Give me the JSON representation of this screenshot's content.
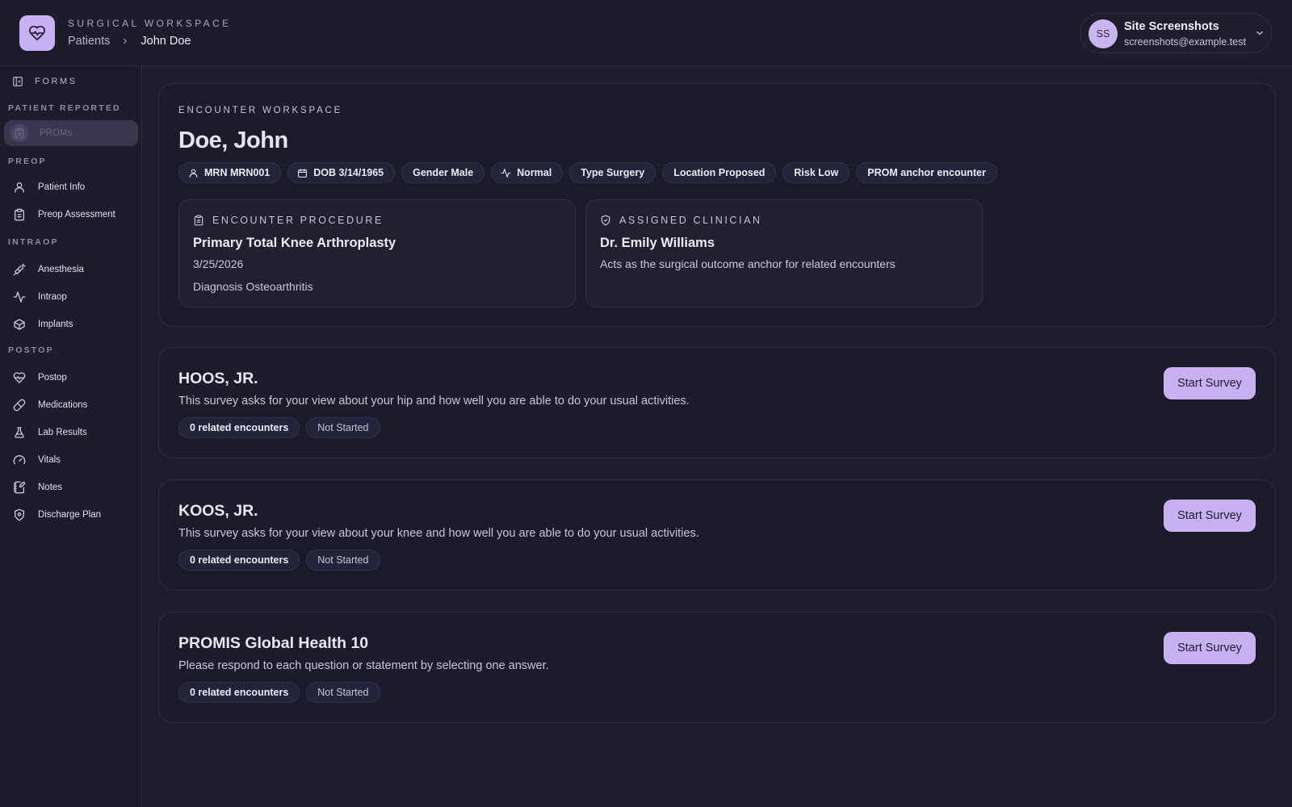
{
  "header": {
    "eyebrow": "SURGICAL WORKSPACE",
    "breadcrumb": [
      "Patients",
      "John Doe"
    ],
    "user": {
      "initials": "SS",
      "name": "Site Screenshots",
      "email": "screenshots@example.test"
    }
  },
  "sidebar": {
    "toggle_label": "FORMS",
    "sections": [
      {
        "label": "PATIENT REPORTED",
        "items": [
          {
            "label": "PROMs",
            "icon": "clipboard-icon",
            "active": true
          }
        ]
      },
      {
        "label": "PREOP",
        "items": [
          {
            "label": "Patient Info",
            "icon": "user-icon"
          },
          {
            "label": "Preop Assessment",
            "icon": "clipboard-icon"
          }
        ]
      },
      {
        "label": "INTRAOP",
        "items": [
          {
            "label": "Anesthesia",
            "icon": "syringe-icon"
          },
          {
            "label": "Intraop",
            "icon": "activity-icon"
          },
          {
            "label": "Implants",
            "icon": "box-icon"
          }
        ]
      },
      {
        "label": "POSTOP",
        "items": [
          {
            "label": "Postop",
            "icon": "heart-pulse-icon"
          },
          {
            "label": "Medications",
            "icon": "pill-icon"
          },
          {
            "label": "Lab Results",
            "icon": "flask-icon"
          },
          {
            "label": "Vitals",
            "icon": "gauge-icon"
          },
          {
            "label": "Notes",
            "icon": "notebook-icon"
          },
          {
            "label": "Discharge Plan",
            "icon": "shield-icon"
          }
        ]
      }
    ]
  },
  "encounter": {
    "eyebrow": "ENCOUNTER WORKSPACE",
    "patient_name": "Doe, John",
    "chips": {
      "mrn": "MRN MRN001",
      "dob": "DOB 3/14/1965",
      "gender": "Gender Male",
      "status": "Normal",
      "type": "Type Surgery",
      "location": "Location Proposed",
      "risk": "Risk Low",
      "anchor": "PROM anchor encounter"
    },
    "procedure": {
      "eyebrow": "ENCOUNTER PROCEDURE",
      "title": "Primary Total Knee Arthroplasty",
      "date": "3/25/2026",
      "diagnosis": "Diagnosis Osteoarthritis"
    },
    "clinician": {
      "eyebrow": "ASSIGNED CLINICIAN",
      "name": "Dr. Emily Williams",
      "note": "Acts as the surgical outcome anchor for related encounters"
    }
  },
  "surveys": [
    {
      "title": "HOOS, JR.",
      "description": "This survey asks for your view about your hip and how well you are able to do your usual activities.",
      "related": "0 related encounters",
      "status": "Not Started",
      "button": "Start Survey"
    },
    {
      "title": "KOOS, JR.",
      "description": "This survey asks for your view about your knee and how well you are able to do your usual activities.",
      "related": "0 related encounters",
      "status": "Not Started",
      "button": "Start Survey"
    },
    {
      "title": "PROMIS Global Health 10",
      "description": "Please respond to each question or statement by selecting one answer.",
      "related": "0 related encounters",
      "status": "Not Started",
      "button": "Start Survey"
    }
  ],
  "colors": {
    "accent": "#c7b1f1",
    "background": "#1d1d2c",
    "card": "#1b1b29",
    "border": "#2e2e40"
  }
}
